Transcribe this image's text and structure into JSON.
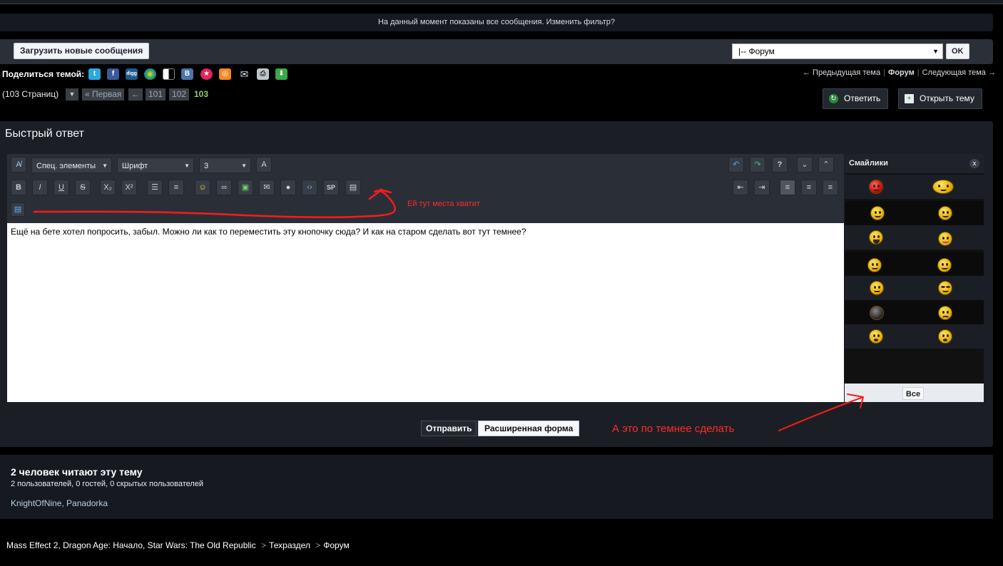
{
  "filter_bar": {
    "text": "На данный момент показаны все сообщения. Изменить фильтр?"
  },
  "toolbar2": {
    "load_new_label": "Загрузить новые сообщения",
    "forum_select_value": "|-- Форум",
    "ok_label": "OK"
  },
  "share": {
    "label": "Поделиться темой:",
    "icons": [
      "twitter-icon",
      "facebook-icon",
      "digg-icon",
      "delicious-icon",
      "mixx-icon",
      "vkontakte-icon",
      "mirtesen-icon",
      "odnoklassniki-icon",
      "email-icon",
      "print-icon",
      "download-icon"
    ]
  },
  "topic_nav": {
    "prev": "← Предыдущая тема",
    "forum": "Форум",
    "next": "Следующая тема →"
  },
  "pagination": {
    "pages_text": "(103 Страниц)",
    "first": "« Первая",
    "prev_arrow": "←",
    "pages": [
      "101",
      "102"
    ],
    "current": "103"
  },
  "actions": {
    "reply": "Ответить",
    "new_topic": "Открыть тему"
  },
  "quick_reply": {
    "title": "Быстрый ответ",
    "special_select": "Спец. элементы",
    "font_select": "Шрифт",
    "size_select": "3",
    "textarea_value": "Ещё на бете хотел попросить, забыл. Можно ли как то переместить эту кнопочку сюда? И как на старом сделать вот тут темнее?"
  },
  "smileys": {
    "title": "Смайлики",
    "close": "x",
    "all_label": "Все"
  },
  "annotations": {
    "note1": "Ей тут места хватит",
    "note2": "А это по темнее сделать"
  },
  "submit": {
    "send": "Отправить",
    "advanced": "Расширенная форма"
  },
  "viewers": {
    "title": "2 человек читают эту тему",
    "subtitle": "2 пользователей, 0 гостей, 0 скрытых пользователей",
    "users": [
      "KnightOfNine",
      "Panadorka"
    ]
  },
  "breadcrumb": {
    "items": [
      "Mass Effect 2, Dragon Age: Начало, Star Wars: The Old Republic",
      "Техраздел",
      "Форум"
    ],
    "separator": ">"
  },
  "colors": {
    "background": "#000000",
    "panel": "#1b1f25",
    "annotation": "#ff2a2a",
    "current_page": "#8fd06a"
  }
}
